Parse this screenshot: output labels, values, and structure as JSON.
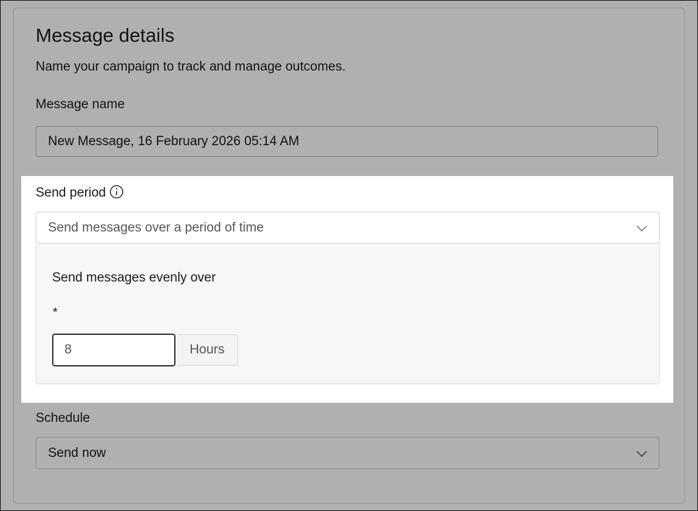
{
  "section": {
    "title": "Message details",
    "subtitle": "Name your campaign to track and manage outcomes."
  },
  "message_name": {
    "label": "Message name",
    "value": "New Message, 16 February 2026 05:14 AM"
  },
  "send_period": {
    "label": "Send period",
    "info_icon": "info-icon",
    "selected": "Send messages over a period of time",
    "panel": {
      "label": "Send messages evenly over",
      "required_marker": "*",
      "value": "8",
      "unit": "Hours"
    }
  },
  "schedule": {
    "label": "Schedule",
    "selected": "Send now"
  },
  "colors": {
    "overlay": "#4f4f4f",
    "highlight": "#ffffff",
    "panel_bg": "#f7f7f7"
  }
}
